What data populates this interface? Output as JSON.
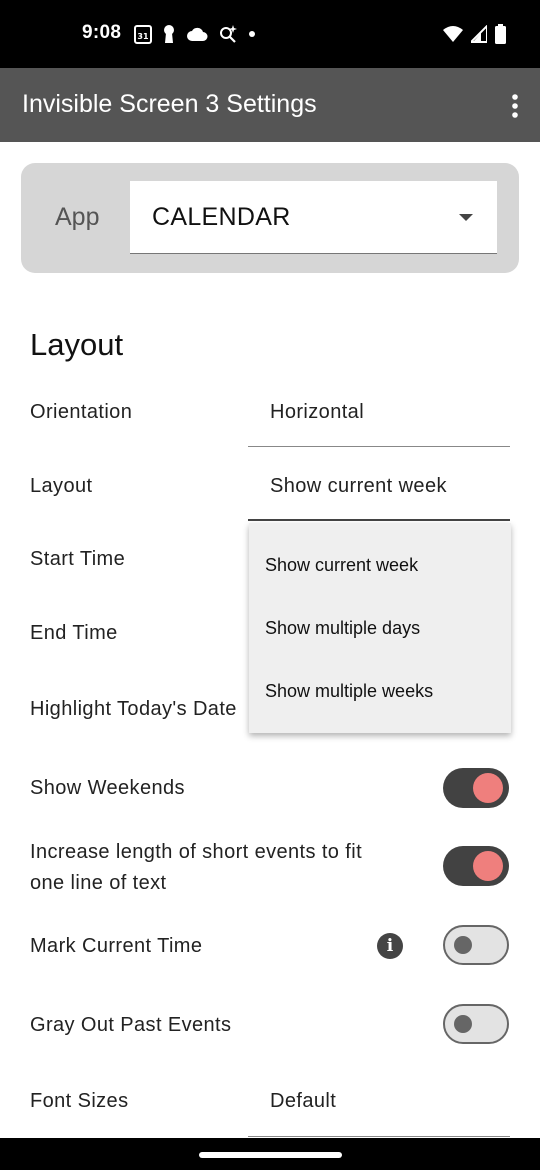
{
  "status_bar": {
    "time": "9:08",
    "calendar_icon_text": "31"
  },
  "app_bar": {
    "title": "Invisible Screen 3 Settings"
  },
  "app_selector": {
    "label": "App",
    "value": "CALENDAR"
  },
  "layout_section": {
    "title": "Layout",
    "orientation": {
      "label": "Orientation",
      "value": "Horizontal"
    },
    "layout": {
      "label": "Layout",
      "value": "Show current week"
    },
    "start_time": {
      "label": "Start Time"
    },
    "end_time": {
      "label": "End Time"
    },
    "highlight_today": {
      "label": "Highlight Today's Date"
    },
    "show_weekends": {
      "label": "Show Weekends",
      "on": true
    },
    "increase_short_events": {
      "label_line1": "Increase length of short events to fit",
      "label_line2": "one line of text",
      "on": true
    },
    "mark_current_time": {
      "label": "Mark Current Time",
      "on": false
    },
    "gray_out_past": {
      "label": "Gray Out Past Events",
      "on": false
    },
    "font_sizes": {
      "label": "Font Sizes",
      "value": "Default"
    }
  },
  "layout_dropdown": {
    "options": [
      "Show current week",
      "Show multiple days",
      "Show multiple weeks"
    ]
  },
  "colors": {
    "app_bar": "#555555",
    "switch_on_knob": "#ef7f7d",
    "switch_on_track": "#424242",
    "card": "#d6d6d6"
  }
}
